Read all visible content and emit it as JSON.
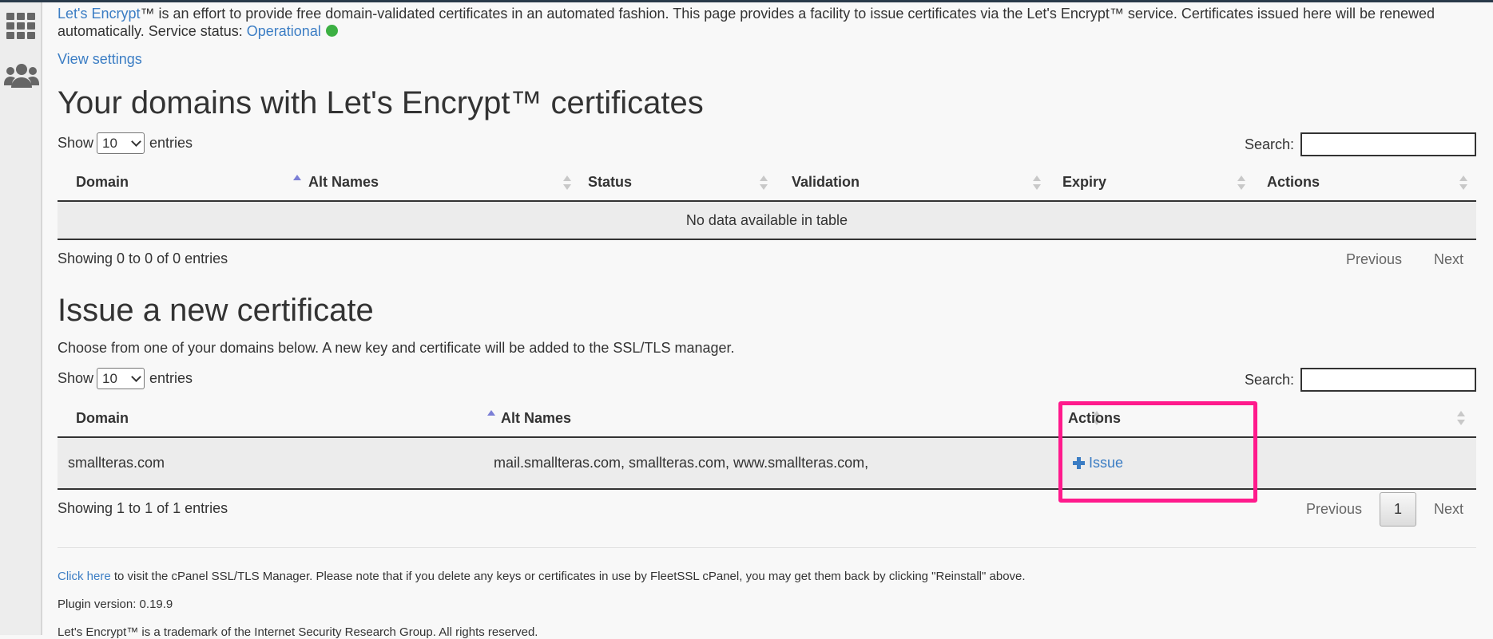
{
  "colors": {
    "link": "#3b7dc4",
    "status_ok": "#3cb043",
    "highlight": "#ff1a8c",
    "row_bg": "#ececec"
  },
  "sidebar": {
    "icons": [
      "apps-grid-icon",
      "users-icon"
    ]
  },
  "intro": {
    "link": "Let's Encrypt",
    "text": "™ is an effort to provide free domain-validated certificates in an automated fashion. This page provides a facility to issue certificates via the Let's Encrypt™ service. Certificates issued here will be renewed automatically. Service status: ",
    "status_label": "Operational"
  },
  "view_settings": "View settings",
  "domains_section": {
    "heading": "Your domains with Let's Encrypt™ certificates",
    "show_label": "Show",
    "show_value": "10",
    "entries_label": "entries",
    "search_label": "Search:",
    "columns": [
      "Domain",
      "Alt Names",
      "Status",
      "Validation",
      "Expiry",
      "Actions"
    ],
    "empty_message": "No data available in table",
    "info": "Showing 0 to 0 of 0 entries",
    "previous": "Previous",
    "next": "Next"
  },
  "issue_section": {
    "heading": "Issue a new certificate",
    "description": "Choose from one of your domains below. A new key and certificate will be added to the SSL/TLS manager.",
    "show_label": "Show",
    "show_value": "10",
    "entries_label": "entries",
    "search_label": "Search:",
    "columns": [
      "Domain",
      "Alt Names",
      "Actions"
    ],
    "rows": [
      {
        "domain": "smallteras.com",
        "alt_names": "mail.smallteras.com, smallteras.com, www.smallteras.com,",
        "action": "Issue"
      }
    ],
    "info": "Showing 1 to 1 of 1 entries",
    "previous": "Previous",
    "page": "1",
    "next": "Next"
  },
  "footer": {
    "click_here": "Click here",
    "manager_text": " to visit the cPanel SSL/TLS Manager. Please note that if you delete any keys or certificates in use by FleetSSL cPanel, you may get them back by clicking \"Reinstall\" above.",
    "plugin_version": "Plugin version: 0.19.9",
    "trademark": "Let's Encrypt™ is a trademark of the Internet Security Research Group. All rights reserved."
  }
}
